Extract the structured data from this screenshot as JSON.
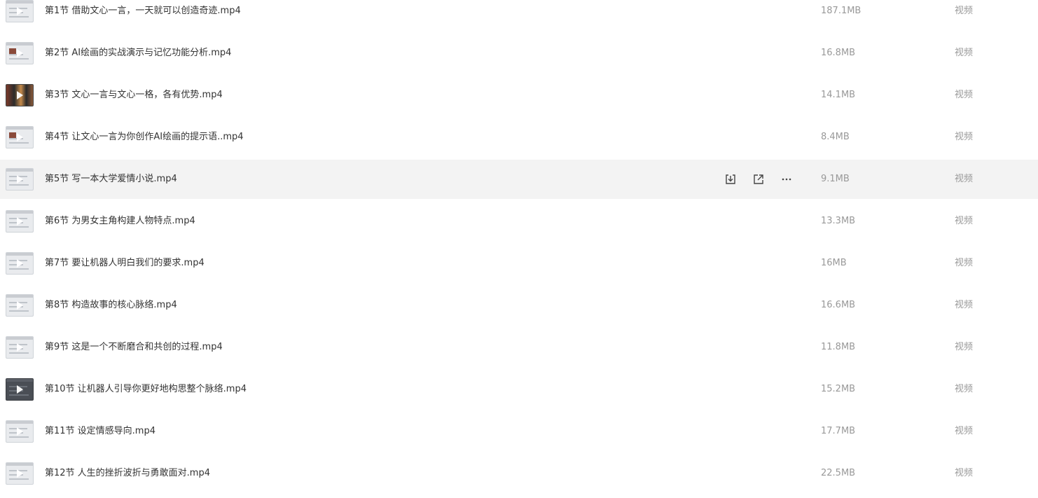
{
  "file_list": {
    "hovered_index": 4,
    "actions": {
      "download_icon": "download-icon",
      "share_icon": "share-icon",
      "more_icon": "more-icon"
    },
    "items": [
      {
        "name": "第1节 借助文心一言，一天就可以创造奇迹.mp4",
        "size": "187.1MB",
        "type": "视频",
        "thumb": "light"
      },
      {
        "name": "第2节 AI绘画的实战演示与记忆功能分析.mp4",
        "size": "16.8MB",
        "type": "视频",
        "thumb": "poster"
      },
      {
        "name": "第3节 文心一言与文心一格，各有优势.mp4",
        "size": "14.1MB",
        "type": "视频",
        "thumb": "photo"
      },
      {
        "name": "第4节 让文心一言为你创作AI绘画的提示语..mp4",
        "size": "8.4MB",
        "type": "视频",
        "thumb": "poster"
      },
      {
        "name": "第5节 写一本大学爱情小说.mp4",
        "size": "9.1MB",
        "type": "视频",
        "thumb": "light"
      },
      {
        "name": "第6节 为男女主角构建人物特点.mp4",
        "size": "13.3MB",
        "type": "视频",
        "thumb": "light"
      },
      {
        "name": "第7节 要让机器人明白我们的要求.mp4",
        "size": "16MB",
        "type": "视频",
        "thumb": "light"
      },
      {
        "name": "第8节 构造故事的核心脉络.mp4",
        "size": "16.6MB",
        "type": "视频",
        "thumb": "light"
      },
      {
        "name": "第9节 这是一个不断磨合和共创的过程.mp4",
        "size": "11.8MB",
        "type": "视频",
        "thumb": "light"
      },
      {
        "name": "第10节 让机器人引导你更好地构思整个脉络.mp4",
        "size": "15.2MB",
        "type": "视频",
        "thumb": "dark"
      },
      {
        "name": "第11节 设定情感导向.mp4",
        "size": "17.7MB",
        "type": "视频",
        "thumb": "light"
      },
      {
        "name": "第12节 人生的挫折波折与勇敢面对.mp4",
        "size": "22.5MB",
        "type": "视频",
        "thumb": "light"
      }
    ]
  }
}
